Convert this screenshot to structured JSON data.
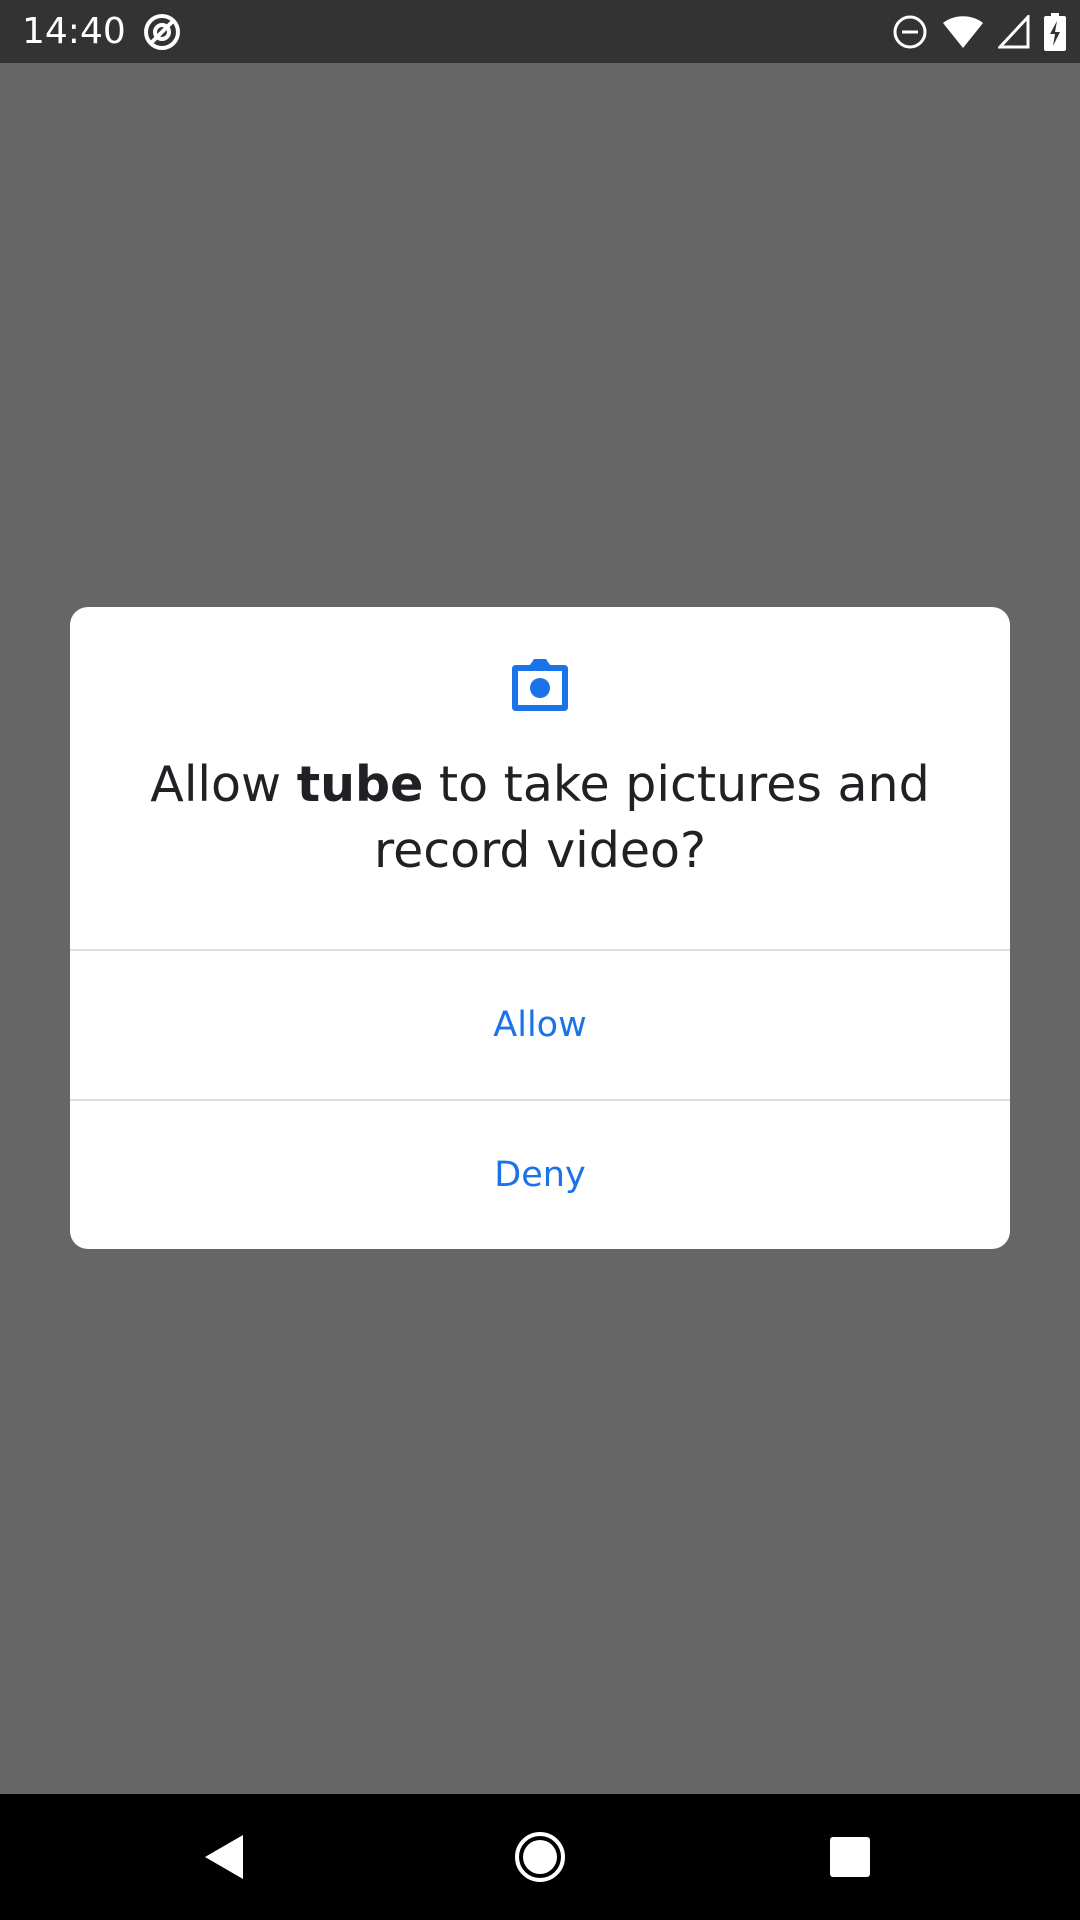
{
  "status_bar": {
    "time": "14:40",
    "icons": [
      "at-sign-icon",
      "do-not-disturb-icon",
      "wifi-icon",
      "cell-signal-icon",
      "battery-charging-icon"
    ]
  },
  "dialog": {
    "icon": "camera-icon",
    "message_prefix": "Allow ",
    "app_name": "tube",
    "message_suffix": " to take pictures and record video?",
    "allow_label": "Allow",
    "deny_label": "Deny"
  },
  "nav_bar": {
    "icons": [
      "back-icon",
      "home-icon",
      "recents-icon"
    ]
  },
  "colors": {
    "accent": "#1a73e8",
    "scrim": "#666666",
    "status_bar": "#333333",
    "nav_bar": "#000000"
  }
}
